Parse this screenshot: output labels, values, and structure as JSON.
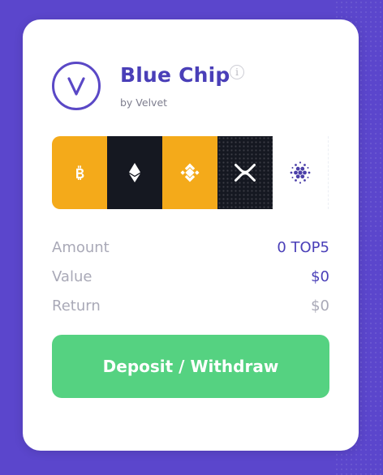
{
  "card": {
    "title": "Blue Chip",
    "subtitle": "by Velvet",
    "logo_letter": "V",
    "info_symbol": "i"
  },
  "tokens": [
    {
      "icon": "bitcoin-icon",
      "bg": "#f4aa1a"
    },
    {
      "icon": "ethereum-icon",
      "bg": "#151821"
    },
    {
      "icon": "binance-icon",
      "bg": "#f4aa1a"
    },
    {
      "icon": "xrp-icon",
      "bg": "#151821"
    },
    {
      "icon": "cardano-icon",
      "bg": "#ffffff"
    }
  ],
  "stats": {
    "amount_label": "Amount",
    "amount_value": "0 TOP5",
    "value_label": "Value",
    "value_value": "$0",
    "return_label": "Return",
    "return_value": "$0"
  },
  "actions": {
    "deposit_withdraw_label": "Deposit / Withdraw"
  },
  "colors": {
    "background": "#5b46cc",
    "accent": "#4a3fb8",
    "button": "#55d281",
    "orange": "#f4aa1a",
    "dark": "#151821"
  }
}
